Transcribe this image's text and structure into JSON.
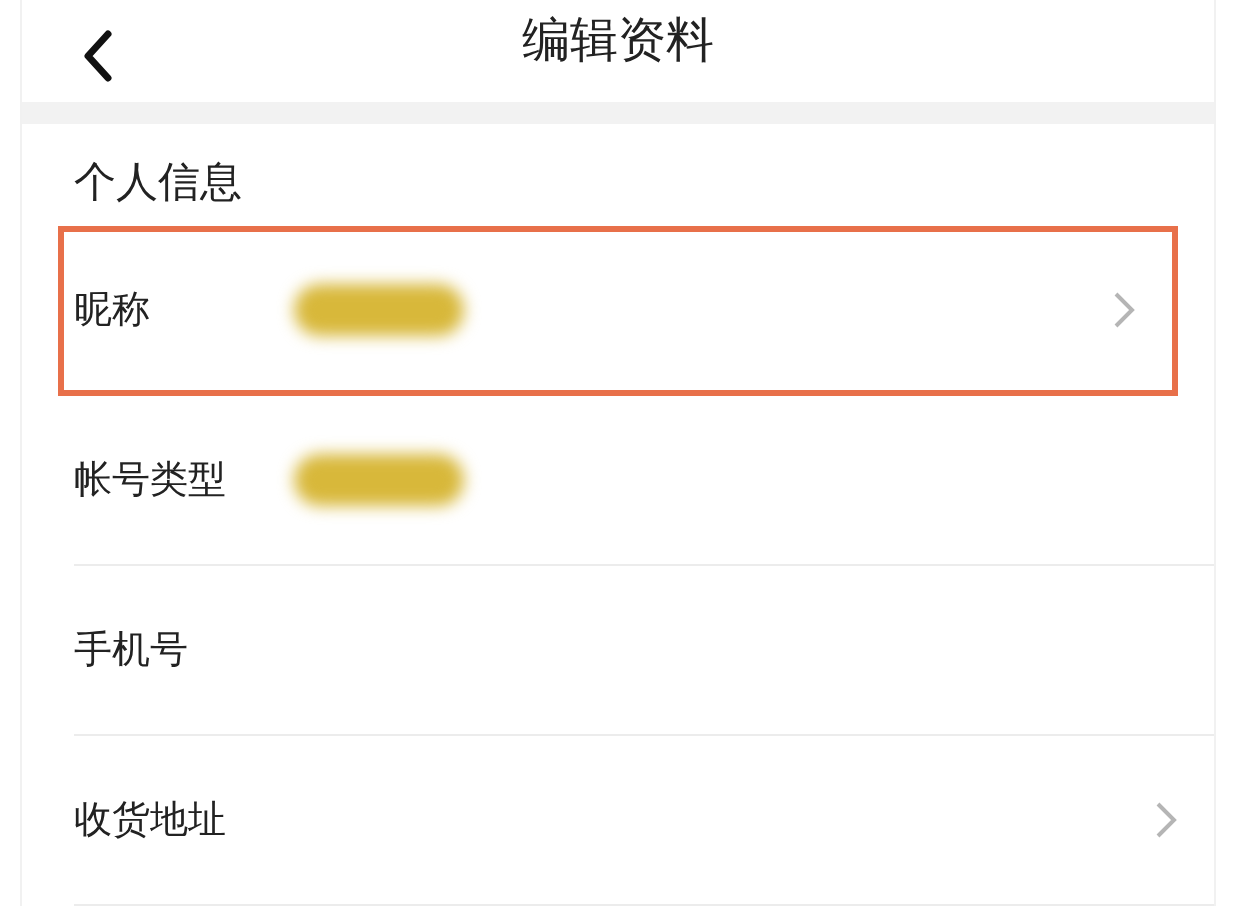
{
  "header": {
    "title": "编辑资料"
  },
  "section": {
    "title": "个人信息"
  },
  "rows": [
    {
      "label": "昵称",
      "redacted": true,
      "chevron": true,
      "highlighted": true
    },
    {
      "label": "帐号类型",
      "redacted": true,
      "chevron": false,
      "highlighted": false
    },
    {
      "label": "手机号",
      "redacted": false,
      "chevron": false,
      "highlighted": false
    },
    {
      "label": "收货地址",
      "redacted": false,
      "chevron": true,
      "highlighted": false
    }
  ]
}
